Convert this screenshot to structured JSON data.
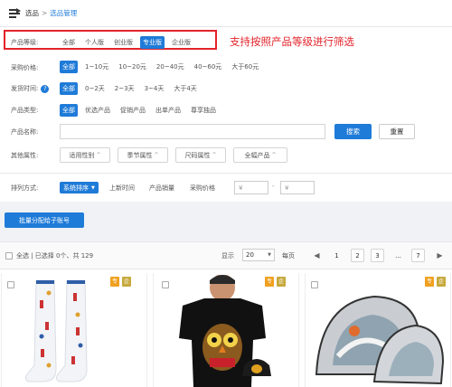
{
  "breadcrumb": {
    "root": "选品",
    "separator": ">",
    "current": "选品管理"
  },
  "annotation": "支持按照产品等级进行筛选",
  "filters": {
    "level": {
      "label": "产品等级:",
      "options": [
        "全部",
        "个人版",
        "创业版",
        "专业版",
        "企业版"
      ],
      "selected": "专业版"
    },
    "price": {
      "label": "采购价格:",
      "options": [
        "全部",
        "1~10元",
        "10~20元",
        "20~40元",
        "40~60元",
        "大于60元"
      ],
      "selected": "全部"
    },
    "ship_time": {
      "label": "发货时间:",
      "help_icon": "question-circle-icon",
      "options": [
        "全部",
        "0~2天",
        "2~3天",
        "3~4天",
        "大于4天"
      ],
      "selected": "全部"
    },
    "type": {
      "label": "产品类型:",
      "options": [
        "全部",
        "优选产品",
        "促销产品",
        "出单产品",
        "尊享独品"
      ],
      "selected": "全部"
    },
    "name": {
      "label": "产品名称:",
      "value": "",
      "search_label": "搜索",
      "reset_label": "重置"
    },
    "other": {
      "label": "其他属性:",
      "attrs": [
        "适用性别",
        "季节属性",
        "尺码属性",
        "全幅产品"
      ],
      "caret_icon": "chevron-up-icon"
    }
  },
  "sort": {
    "label": "排列方式:",
    "selected": "系统排序",
    "options": [
      "上新时间",
      "产品销量",
      "采购价格"
    ],
    "price_symbol_from": "¥",
    "price_symbol_to": "¥",
    "dash": "-"
  },
  "assign_button": "批量分配给子账号",
  "list": {
    "select_all": "全选 | 已选择 0个、共 129",
    "show_label": "显示",
    "page_size": "20",
    "per_page_label": "每页",
    "pages": [
      "1",
      "2",
      "3",
      "...",
      "7"
    ],
    "current_page": "1",
    "prev_icon": "chevron-left-icon",
    "next_icon": "chevron-right-icon"
  },
  "products": [
    {
      "image": "striped-socks-image",
      "tags": [
        "专",
        "企"
      ]
    },
    {
      "image": "owl-tshirt-image",
      "tags": [
        "专",
        "企"
      ]
    },
    {
      "image": "cosmetic-bag-image",
      "tags": [
        "专",
        "企"
      ]
    }
  ],
  "colors": {
    "accent": "#1f7bd8",
    "highlight": "#e3232b",
    "tag_orange": "#f0a020",
    "tag_gold": "#c7a93d"
  }
}
